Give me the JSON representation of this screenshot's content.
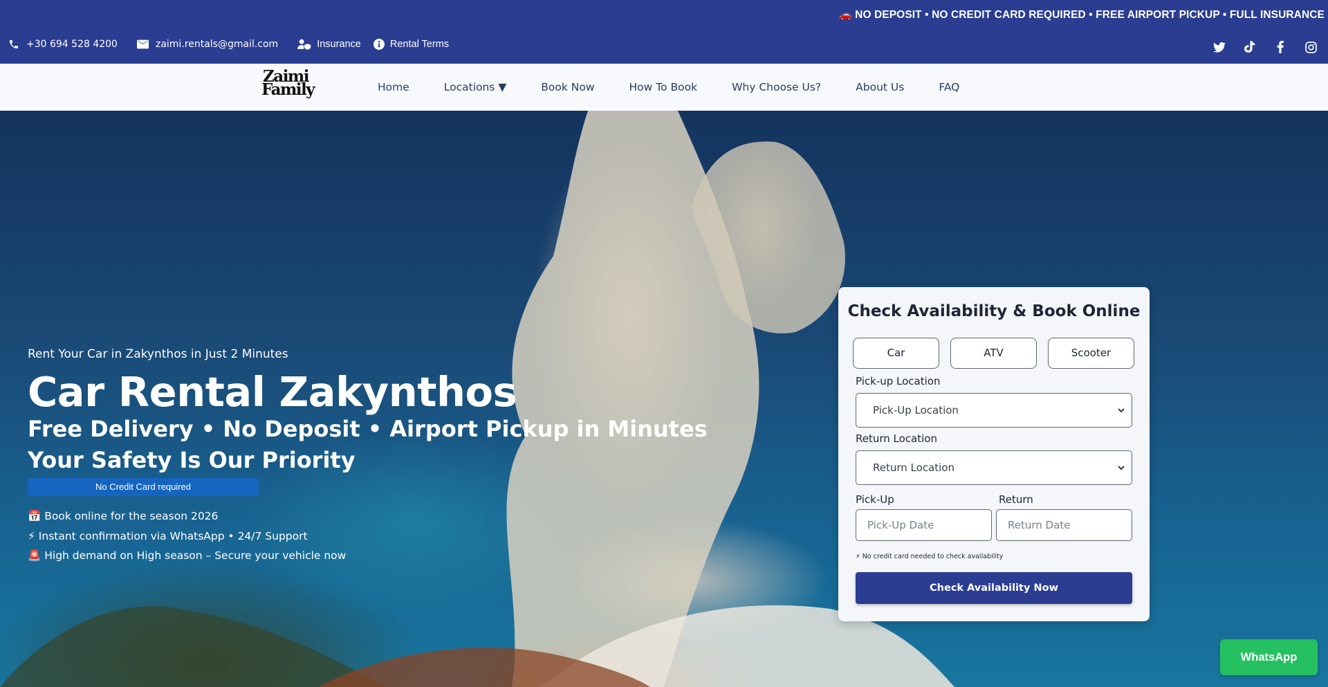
{
  "topbar": {
    "ticker_icon": "car-icon",
    "ticker": "NO DEPOSIT • NO CREDIT CARD REQUIRED • FREE AIRPORT PICKUP • FULL INSURANCE",
    "phone": "+30 694 528 4200",
    "email": "zaimi.rentals@gmail.com",
    "insurance": "Insurance",
    "rental_terms": "Rental Terms",
    "socials": [
      "twitter-icon",
      "tiktok-icon",
      "facebook-icon",
      "instagram-icon"
    ],
    "background": "#2a3d91"
  },
  "header": {
    "logo_line1": "Zaimi",
    "logo_line2": "Family",
    "nav": [
      "Home",
      "Locations ▼",
      "Book Now",
      "How To Book",
      "Why Choose Us?",
      "About Us",
      "FAQ"
    ]
  },
  "hero": {
    "subtitle": "Rent Your Car in Zakynthos in Just 2 Minutes",
    "title": "Car Rental Zakynthos",
    "line1": "Free Delivery • No Deposit • Airport Pickup in Minutes",
    "line2": "Your Safety Is Our Priority",
    "badge": "No Credit Card required",
    "bullets": [
      "📅 Book online for the season 2026",
      "⚡ Instant confirmation via WhatsApp • 24/7 Support",
      "🚨 High demand on High season – Secure your vehicle now"
    ]
  },
  "booking": {
    "title": "Check Availability & Book Online",
    "vehicle_tabs": [
      "Car",
      "ATV",
      "Scooter"
    ],
    "pickup_location_label": "Pick-up Location",
    "pickup_location_value": "Pick-Up Location",
    "return_location_label": "Return Location",
    "return_location_value": "Return Location",
    "pickup_date_label": "Pick-Up",
    "return_date_label": "Return",
    "pickup_date_placeholder": "Pick-Up Date",
    "return_date_placeholder": "Return Date",
    "note": "⚡ No credit card needed to check availability",
    "cta": "Check Availability Now",
    "cta_color": "#2a3d91"
  },
  "whatsapp": {
    "label": "WhatsApp",
    "color": "#25c160"
  }
}
